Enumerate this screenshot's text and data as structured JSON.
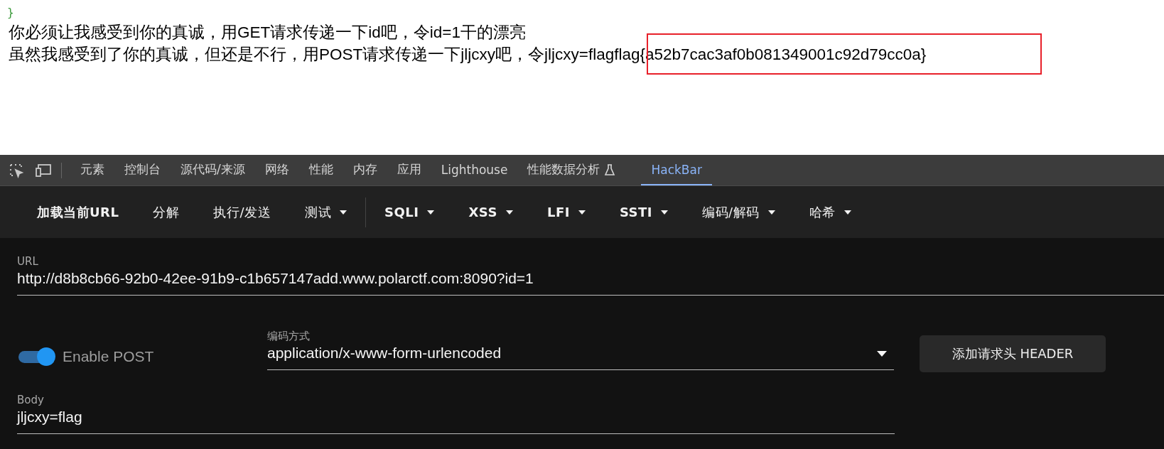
{
  "page": {
    "code_lines": [
      "}"
    ],
    "lines": [
      "你必须让我感受到你的真诚，用GET请求传递一下id吧，令id=1干的漂亮",
      "虽然我感受到了你的真诚，但还是不行，用POST请求传递一下jljcxy吧，令jljcxy=flagflag{a52b7cac3af0b081349001c92d79cc0a}"
    ]
  },
  "devtools_tabs": [
    {
      "label": "元素",
      "selected": false,
      "experimental": false
    },
    {
      "label": "控制台",
      "selected": false,
      "experimental": false
    },
    {
      "label": "源代码/来源",
      "selected": false,
      "experimental": false
    },
    {
      "label": "网络",
      "selected": false,
      "experimental": false
    },
    {
      "label": "性能",
      "selected": false,
      "experimental": false
    },
    {
      "label": "内存",
      "selected": false,
      "experimental": false
    },
    {
      "label": "应用",
      "selected": false,
      "experimental": false
    },
    {
      "label": "Lighthouse",
      "selected": false,
      "experimental": false
    },
    {
      "label": "性能数据分析",
      "selected": false,
      "experimental": true
    },
    {
      "label": "HackBar",
      "selected": true,
      "experimental": false
    }
  ],
  "toolbar": [
    {
      "label": "加载当前URL",
      "dropdown": false
    },
    {
      "label": "分解",
      "dropdown": false
    },
    {
      "label": "执行/发送",
      "dropdown": false
    },
    {
      "label": "测试",
      "dropdown": true
    },
    {
      "label": "SQLI",
      "dropdown": true,
      "divider_before": true
    },
    {
      "label": "XSS",
      "dropdown": true
    },
    {
      "label": "LFI",
      "dropdown": true
    },
    {
      "label": "SSTI",
      "dropdown": true
    },
    {
      "label": "编码/解码",
      "dropdown": true
    },
    {
      "label": "哈希",
      "dropdown": true
    }
  ],
  "url": {
    "label": "URL",
    "value": "http://d8b8cb66-92b0-42ee-91b9-c1b657147add.www.polarctf.com:8090?id=1"
  },
  "enable_post": {
    "label": "Enable POST",
    "on": true
  },
  "encoding": {
    "label": "编码方式",
    "value": "application/x-www-form-urlencoded"
  },
  "header_button": "添加请求头 HEADER",
  "body": {
    "label": "Body",
    "value": "jljcxy=flag"
  }
}
